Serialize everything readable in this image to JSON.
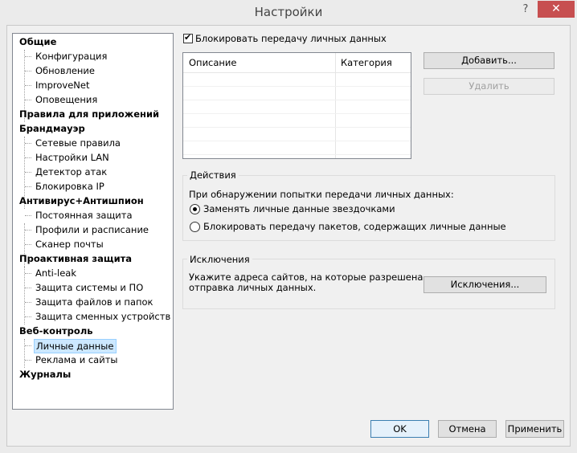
{
  "window": {
    "title": "Настройки",
    "help_label": "?",
    "close_label": "✕"
  },
  "tree": {
    "categories": [
      {
        "label": "Общие",
        "children": [
          "Конфигурация",
          "Обновление",
          "ImproveNet",
          "Оповещения"
        ]
      },
      {
        "label": "Правила для приложений",
        "children": []
      },
      {
        "label": "Брандмауэр",
        "children": [
          "Сетевые правила",
          "Настройки LAN",
          "Детектор атак",
          "Блокировка IP"
        ]
      },
      {
        "label": "Антивирус+Антишпион",
        "children": [
          "Постоянная защита",
          "Профили и расписание",
          "Сканер почты"
        ]
      },
      {
        "label": "Проактивная защита",
        "children": [
          "Anti-leak",
          "Защита системы и ПО",
          "Защита файлов и папок",
          "Защита сменных устройств"
        ]
      },
      {
        "label": "Веб-контроль",
        "children": [
          "Личные данные",
          "Реклама и сайты"
        ]
      },
      {
        "label": "Журналы",
        "children": []
      }
    ],
    "selected": "Личные данные"
  },
  "main": {
    "block_checkbox_label": "Блокировать передачу личных данных",
    "block_checked": true,
    "table": {
      "columns": [
        "Описание",
        "Категория"
      ],
      "rows": []
    },
    "add_button": "Добавить...",
    "delete_button": "Удалить",
    "actions": {
      "title": "Действия",
      "prompt": "При обнаружении попытки передачи личных данных:",
      "option_replace": "Заменять личные данные звездочками",
      "option_block": "Блокировать передачу пакетов, содержащих личные данные",
      "selected": "replace"
    },
    "exceptions": {
      "title": "Исключения",
      "description_line1": "Укажите адреса сайтов, на которые разрешена",
      "description_line2": "отправка личных данных.",
      "button": "Исключения..."
    }
  },
  "footer": {
    "ok": "OK",
    "cancel": "Отмена",
    "apply": "Применить"
  }
}
